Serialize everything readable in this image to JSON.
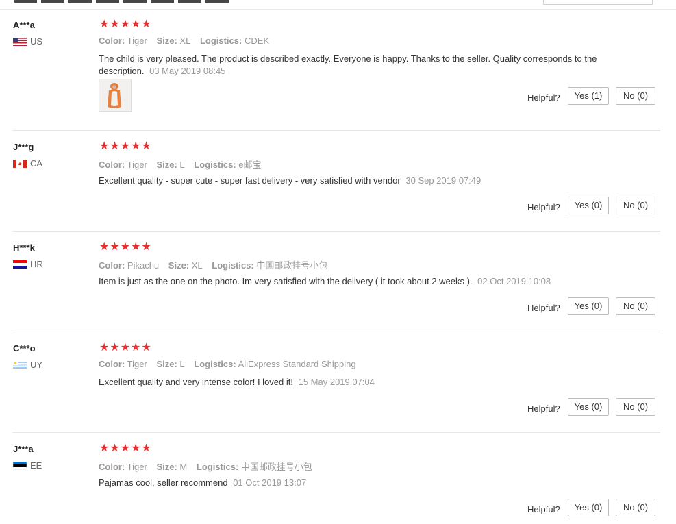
{
  "reviews": [
    {
      "user": "A***a",
      "country": "US",
      "flag_colors": [
        "#b22234",
        "#ffffff",
        "#3c3b6e"
      ],
      "rating": 5,
      "color_label": "Color:",
      "color_value": "Tiger",
      "size_label": "Size:",
      "size_value": "XL",
      "logistics_label": "Logistics:",
      "logistics_value": "CDEK",
      "text": "The child is very pleased. The product is described exactly. Everyone is happy. Thanks to the seller. Quality corresponds to the description.",
      "date": "03 May 2019 08:45",
      "has_photo": true,
      "helpful_label": "Helpful?",
      "yes_label": "Yes (1)",
      "no_label": "No (0)"
    },
    {
      "user": "J***g",
      "country": "CA",
      "flag_colors": [
        "#d52b1e",
        "#ffffff"
      ],
      "rating": 5,
      "color_label": "Color:",
      "color_value": "Tiger",
      "size_label": "Size:",
      "size_value": "L",
      "logistics_label": "Logistics:",
      "logistics_value": "e邮宝",
      "text": "Excellent quality - super cute - super fast delivery - very satisfied with vendor",
      "date": "30 Sep 2019 07:49",
      "has_photo": false,
      "helpful_label": "Helpful?",
      "yes_label": "Yes (0)",
      "no_label": "No (0)"
    },
    {
      "user": "H***k",
      "country": "HR",
      "flag_colors": [
        "#ff0000",
        "#ffffff",
        "#171796"
      ],
      "rating": 5,
      "color_label": "Color:",
      "color_value": "Pikachu",
      "size_label": "Size:",
      "size_value": "XL",
      "logistics_label": "Logistics:",
      "logistics_value": "中国邮政挂号小包",
      "text": "Item is just as the one on the photo. Im very satisfied with the delivery ( it took about 2 weeks ).",
      "date": "02 Oct 2019 10:08",
      "has_photo": false,
      "helpful_label": "Helpful?",
      "yes_label": "Yes (0)",
      "no_label": "No (0)"
    },
    {
      "user": "C***o",
      "country": "UY",
      "flag_colors": [
        "#0038a8",
        "#ffffff",
        "#fcd116"
      ],
      "rating": 5,
      "color_label": "Color:",
      "color_value": "Tiger",
      "size_label": "Size:",
      "size_value": "L",
      "logistics_label": "Logistics:",
      "logistics_value": "AliExpress Standard Shipping",
      "text": "Excellent quality and very intense color! I loved it!",
      "date": "15 May 2019 07:04",
      "has_photo": false,
      "helpful_label": "Helpful?",
      "yes_label": "Yes (0)",
      "no_label": "No (0)"
    },
    {
      "user": "J***a",
      "country": "EE",
      "flag_colors": [
        "#0072ce",
        "#000000",
        "#ffffff"
      ],
      "rating": 5,
      "color_label": "Color:",
      "color_value": "Tiger",
      "size_label": "Size:",
      "size_value": "M",
      "logistics_label": "Logistics:",
      "logistics_value": "中国邮政挂号小包",
      "text": "Pajamas cool, seller recommend",
      "date": "01 Oct 2019 13:07",
      "has_photo": false,
      "helpful_label": "Helpful?",
      "yes_label": "Yes (0)",
      "no_label": "No (0)"
    }
  ],
  "colors": {
    "star": "#e62e2e",
    "muted": "#999999",
    "text": "#333333",
    "divider": "#e6e6e6"
  }
}
